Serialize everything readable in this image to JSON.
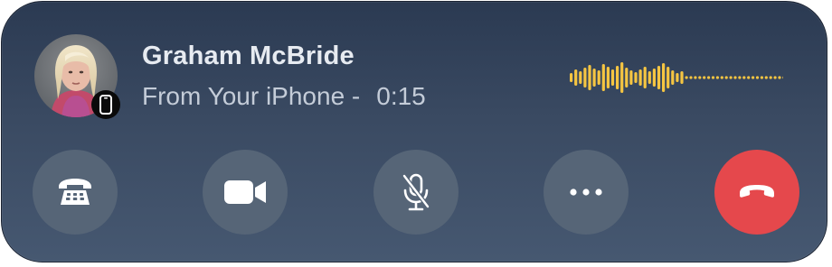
{
  "caller": {
    "name": "Graham McBride",
    "source": "From Your iPhone -",
    "duration": "0:15",
    "avatar_icon": "person-photo",
    "device_icon": "iphone-icon"
  },
  "audio": {
    "waveform_icon": "audio-waveform",
    "accent_color": "#f5c542"
  },
  "controls": [
    {
      "id": "keypad",
      "icon": "keypad-phone-icon"
    },
    {
      "id": "video",
      "icon": "video-camera-icon"
    },
    {
      "id": "mute",
      "icon": "microphone-slash-icon"
    },
    {
      "id": "more",
      "icon": "ellipsis-icon"
    },
    {
      "id": "end",
      "icon": "end-call-icon",
      "color": "#e5484c"
    }
  ]
}
